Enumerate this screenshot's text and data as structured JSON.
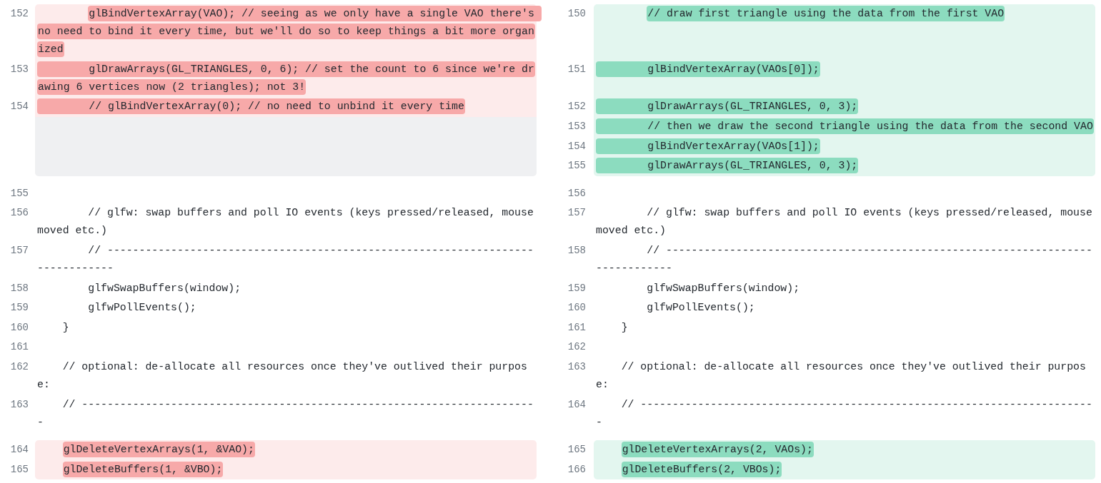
{
  "hunks": [
    {
      "kind": "change",
      "rows": [
        {
          "left": {
            "num": "152",
            "text": "        glBindVertexArray(VAO); // seeing as we only have a single VAO there's no need to bind it every time, but we'll do so to keep things a bit more organized",
            "changed": true,
            "indent_marked": false
          },
          "right": {
            "num": "150",
            "text": "        // draw first triangle using the data from the first VAO",
            "changed": true,
            "indent_marked": false
          }
        },
        {
          "left": {
            "num": "153",
            "text": "        glDrawArrays(GL_TRIANGLES, 0, 6); // set the count to 6 since we're drawing 6 vertices now (2 triangles); not 3!",
            "changed": true,
            "indent_marked": true
          },
          "right": {
            "num": "151",
            "text": "        glBindVertexArray(VAOs[0]);",
            "changed": true,
            "indent_marked": true
          }
        },
        {
          "left": {
            "num": "154",
            "text": "        // glBindVertexArray(0); // no need to unbind it every time",
            "changed": true,
            "indent_marked": true
          },
          "right": {
            "num": "152",
            "text": "        glDrawArrays(GL_TRIANGLES, 0, 3);",
            "changed": true,
            "indent_marked": true
          }
        },
        {
          "left": null,
          "right": {
            "num": "153",
            "text": "        // then we draw the second triangle using the data from the second VAO",
            "changed": true,
            "indent_marked": true
          }
        },
        {
          "left": null,
          "right": {
            "num": "154",
            "text": "        glBindVertexArray(VAOs[1]);",
            "changed": true,
            "indent_marked": true
          }
        },
        {
          "left": null,
          "right": {
            "num": "155",
            "text": "        glDrawArrays(GL_TRIANGLES, 0, 3);",
            "changed": true,
            "indent_marked": true
          }
        }
      ]
    },
    {
      "kind": "context",
      "rows": [
        {
          "left": {
            "num": "155"
          },
          "right": {
            "num": "156"
          }
        },
        {
          "left": {
            "num": "156",
            "text": "        // glfw: swap buffers and poll IO events (keys pressed/released, mouse moved etc.)",
            "changed": false
          },
          "right": {
            "num": "157",
            "text": "        // glfw: swap buffers and poll IO events (keys pressed/released, mouse moved etc.)",
            "changed": false
          }
        },
        {
          "left": {
            "num": "157",
            "text": "        // -------------------------------------------------------------------------------",
            "changed": false
          },
          "right": {
            "num": "158",
            "text": "        // -------------------------------------------------------------------------------",
            "changed": false
          }
        },
        {
          "left": {
            "num": "158",
            "text": "        glfwSwapBuffers(window);",
            "changed": false
          },
          "right": {
            "num": "159",
            "text": "        glfwSwapBuffers(window);",
            "changed": false
          }
        },
        {
          "left": {
            "num": "159",
            "text": "        glfwPollEvents();",
            "changed": false
          },
          "right": {
            "num": "160",
            "text": "        glfwPollEvents();",
            "changed": false
          }
        },
        {
          "left": {
            "num": "160",
            "text": "    }",
            "changed": false
          },
          "right": {
            "num": "161",
            "text": "    }",
            "changed": false
          }
        },
        {
          "left": {
            "num": "161"
          },
          "right": {
            "num": "162"
          }
        },
        {
          "left": {
            "num": "162",
            "text": "    // optional: de-allocate all resources once they've outlived their purpose:",
            "changed": false
          },
          "right": {
            "num": "163",
            "text": "    // optional: de-allocate all resources once they've outlived their purpose:",
            "changed": false
          }
        },
        {
          "left": {
            "num": "163",
            "text": "    // ------------------------------------------------------------------------",
            "changed": false
          },
          "right": {
            "num": "164",
            "text": "    // ------------------------------------------------------------------------",
            "changed": false
          }
        }
      ]
    },
    {
      "kind": "change",
      "rows": [
        {
          "left": {
            "num": "164",
            "text": "    glDeleteVertexArrays(1, &VAO);",
            "changed": true,
            "indent_marked": false
          },
          "right": {
            "num": "165",
            "text": "    glDeleteVertexArrays(2, VAOs);",
            "changed": true,
            "indent_marked": false
          }
        },
        {
          "left": {
            "num": "165",
            "text": "    glDeleteBuffers(1, &VBO);",
            "changed": true,
            "indent_marked": false
          },
          "right": {
            "num": "166",
            "text": "    glDeleteBuffers(2, VBOs);",
            "changed": true,
            "indent_marked": false
          }
        }
      ]
    }
  ]
}
